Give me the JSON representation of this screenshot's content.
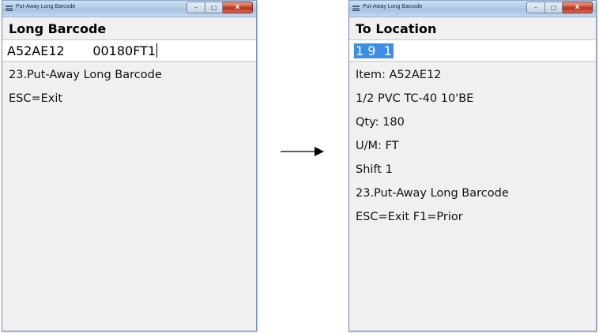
{
  "left_window": {
    "title": "Put-Away Long Barcode",
    "heading": "Long Barcode",
    "input_value": "A52AE12       00180FT1",
    "lines": [
      "23.Put-Away Long Barcode",
      "ESC=Exit"
    ]
  },
  "right_window": {
    "title": "Put-Away Long Barcode",
    "heading": "To Location",
    "input_value": "1 9  1",
    "lines": [
      "Item: A52AE12",
      "1/2 PVC TC-40 10'BE",
      "Qty: 180",
      "U/M: FT",
      "Shift 1",
      "23.Put-Away Long Barcode",
      "ESC=Exit F1=Prior"
    ]
  },
  "window_controls": {
    "minimize": "–",
    "maximize": "□",
    "close": "x"
  },
  "icons": {
    "app_icon": "app-menu-icon",
    "arrow": "right-arrow-icon"
  },
  "colors": {
    "selection": "#3b8ee8",
    "titlebar": "#b3cde8",
    "close_button": "#c9442c",
    "window_bg": "#f0f0f0"
  }
}
